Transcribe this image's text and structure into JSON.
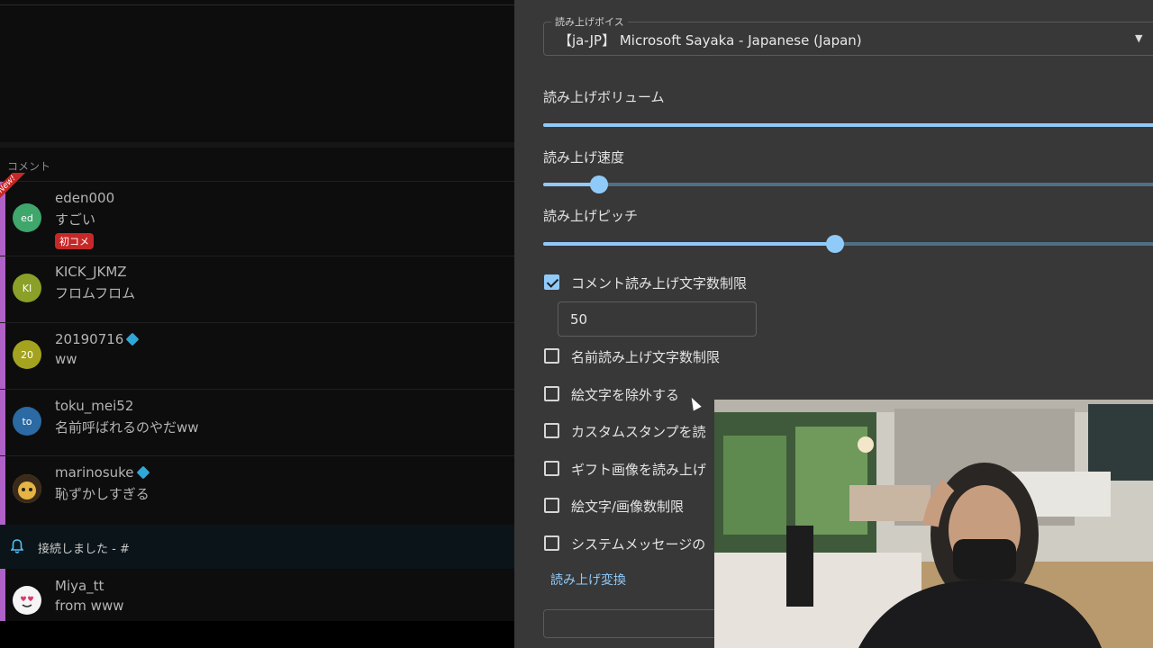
{
  "comments_panel": {
    "section_label": "コメント",
    "comments": [
      {
        "avatar_text": "ed",
        "avatar_color": "#3fa66c",
        "username": "eden000",
        "text": "すごい",
        "badge": "初コメ",
        "new_ribbon": "New!"
      },
      {
        "avatar_text": "KI",
        "avatar_color": "#8aa028",
        "username": "KICK_JKMZ",
        "text": "フロムフロム"
      },
      {
        "avatar_text": "20",
        "avatar_color": "#a3a31f",
        "username": "20190716",
        "text": "ww",
        "member_icon": "member-diamond-icon"
      },
      {
        "avatar_text": "to",
        "avatar_color": "#2b6aa3",
        "username": "toku_mei52",
        "text": "名前呼ばれるのやだww"
      },
      {
        "avatar_text": "",
        "avatar_color": "#d9a636",
        "username": "marinosuke",
        "text": "恥ずかしすぎる",
        "member_icon": "member-diamond-icon"
      }
    ],
    "system_message": "接続しました - #",
    "last_comment": {
      "avatar_text": "",
      "avatar_color": "#d83b6c",
      "username": "Miya_tt",
      "text": "from www"
    }
  },
  "settings": {
    "voice": {
      "legend": "読み上げボイス",
      "value": "【ja-JP】 Microsoft Sayaka - Japanese (Japan)"
    },
    "volume": {
      "label": "読み上げボリューム",
      "value": 1.0
    },
    "speed": {
      "label": "読み上げ速度",
      "value": 0.09
    },
    "pitch": {
      "label": "読み上げピッチ",
      "value": 0.47
    },
    "checkboxes": [
      {
        "label": "コメント読み上げ文字数制限",
        "checked": true
      },
      {
        "label": "名前読み上げ文字数制限",
        "checked": false
      },
      {
        "label": "絵文字を除外する",
        "checked": false
      },
      {
        "label": "カスタムスタンプを読",
        "checked": false
      },
      {
        "label": "ギフト画像を読み上げ",
        "checked": false
      },
      {
        "label": "絵文字/画像数制限",
        "checked": false
      },
      {
        "label": "システムメッセージの",
        "checked": false
      }
    ],
    "comment_limit_value": "50",
    "conversion_link": "読み上げ変換"
  },
  "colors": {
    "accent": "#90caf9",
    "panel_bg": "#383838",
    "left_bg": "#0d0d0d"
  }
}
